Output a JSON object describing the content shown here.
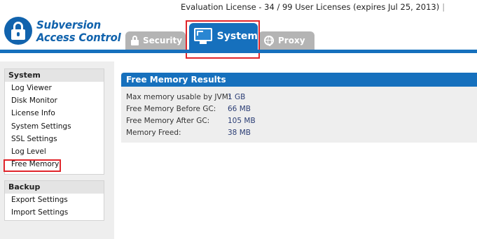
{
  "header": {
    "brand_line1": "Subversion",
    "brand_line2": "Access Control",
    "license_text": "Evaluation License - 34 / 99 User Licenses (expires Jul 25, 2013)",
    "license_separator": "|"
  },
  "tabs": [
    {
      "label": "Security",
      "icon": "lock-icon",
      "active": false
    },
    {
      "label": "System",
      "icon": "monitor-icon",
      "active": true
    },
    {
      "label": "Proxy",
      "icon": "globe-icon",
      "active": false
    }
  ],
  "sidebar": {
    "system": {
      "title": "System",
      "items": [
        "Log Viewer",
        "Disk Monitor",
        "License Info",
        "System Settings",
        "SSL Settings",
        "Log Level",
        "Free Memory"
      ]
    },
    "backup": {
      "title": "Backup",
      "items": [
        "Export Settings",
        "Import Settings"
      ]
    }
  },
  "results": {
    "title": "Free Memory Results",
    "rows": [
      {
        "label": "Max memory usable by JVM:",
        "value": "1 GB"
      },
      {
        "label": "Free Memory Before GC:",
        "value": "66 MB"
      },
      {
        "label": "Free Memory After GC:",
        "value": "105 MB"
      },
      {
        "label": "Memory Freed:",
        "value": "38 MB"
      }
    ]
  },
  "colors": {
    "accent": "#1670bd",
    "highlight": "#e0252b",
    "inactive_tab": "#b4b4b4"
  }
}
